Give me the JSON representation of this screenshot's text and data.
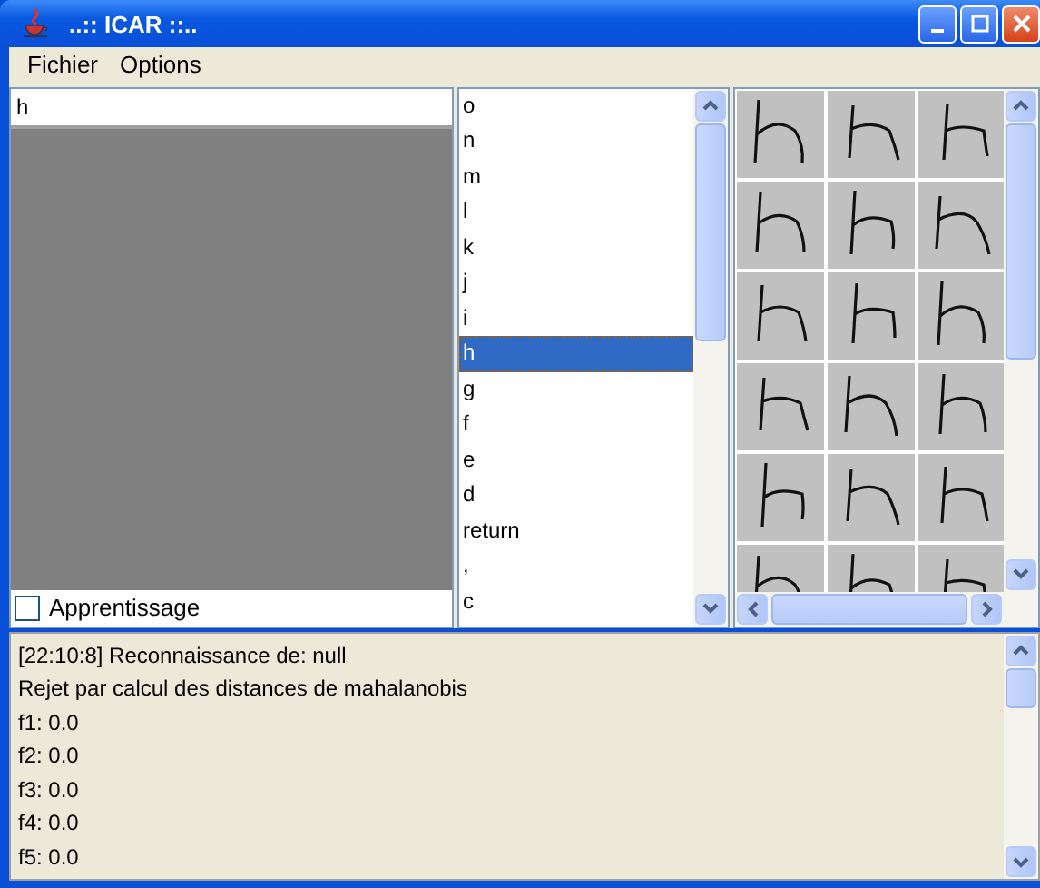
{
  "window": {
    "title": "..:: ICAR ::.."
  },
  "menu": [
    {
      "label": "Fichier"
    },
    {
      "label": "Options"
    }
  ],
  "input": {
    "value": "h"
  },
  "learning": {
    "label": "Apprentissage",
    "checked": false
  },
  "symbols": [
    {
      "label": "o",
      "selected": false
    },
    {
      "label": "n",
      "selected": false
    },
    {
      "label": "m",
      "selected": false
    },
    {
      "label": "l",
      "selected": false
    },
    {
      "label": "k",
      "selected": false
    },
    {
      "label": "j",
      "selected": false
    },
    {
      "label": "i",
      "selected": false
    },
    {
      "label": "h",
      "selected": true
    },
    {
      "label": "g",
      "selected": false
    },
    {
      "label": "f",
      "selected": false
    },
    {
      "label": "e",
      "selected": false
    },
    {
      "label": "d",
      "selected": false
    },
    {
      "label": "return",
      "selected": false
    },
    {
      "label": ",",
      "selected": false
    },
    {
      "label": "c",
      "selected": false
    }
  ],
  "log": [
    "[22:10:8] Reconnaissance de: null",
    "Rejet par calcul des distances de mahalanobis",
    "f1: 0.0",
    "f2: 0.0",
    "f3: 0.0",
    "f4: 0.0",
    "f5: 0.0"
  ]
}
